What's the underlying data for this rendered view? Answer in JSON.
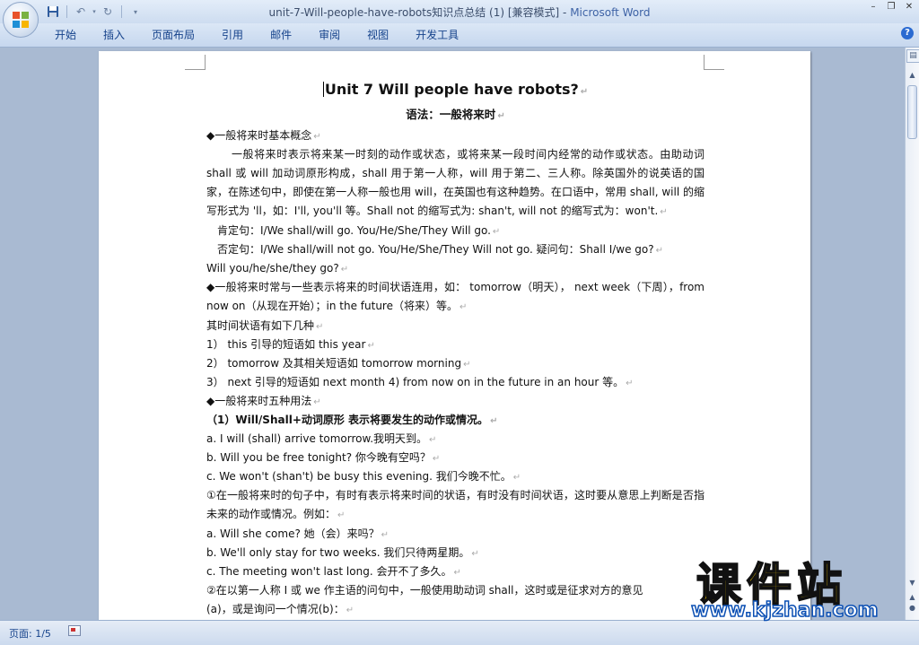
{
  "window": {
    "title_doc": "unit-7-Will-people-have-robots知识点总结 (1) [兼容模式] - ",
    "title_app": "Microsoft Word",
    "controls": [
      "–",
      "❐",
      "✕"
    ]
  },
  "qat": {
    "save_icon": "save-icon",
    "undo_icon": "undo-icon",
    "redo_icon": "redo-icon"
  },
  "ribbon": {
    "tabs": [
      "开始",
      "插入",
      "页面布局",
      "引用",
      "邮件",
      "审阅",
      "视图",
      "开发工具"
    ],
    "help": "?"
  },
  "document": {
    "title": "Unit 7 Will people have robots?",
    "subtitle": "语法：一般将来时",
    "lines": [
      "◆一般将来时基本概念",
      "一般将来时表示将来某一时刻的动作或状态，或将来某一段时间内经常的动作或状态。由助动词 shall 或 will 加动词原形构成，shall 用于第一人称，will 用于第二、三人称。除英国外的说英语的国家，在陈述句中，即使在第一人称一般也用 will，在英国也有这种趋势。在口语中，常用 shall, will 的缩写形式为 'll，如：I'll, you'll 等。Shall not 的缩写式为: shan't, will not 的缩写式为：won't.",
      "肯定句：I/We shall/will go.    You/He/She/They  Will go.",
      "否定句：I/We shall/will not go.    You/He/She/They  Will not go.     疑问句：Shall I/we go?",
      "Will you/he/she/they  go?",
      "◆一般将来时常与一些表示将来的时间状语连用，如： tomorrow（明天）， next week（下周），from now on（从现在开始）；in the future（将来）等。",
      "其时间状语有如下几种",
      "1） this 引导的短语如 this year",
      "2） tomorrow 及其相关短语如 tomorrow morning",
      "3） next 引导的短语如 next month 4) from now on  in the future  in an hour 等。",
      "◆一般将来时五种用法",
      "（1）Will/Shall+动词原形 表示将要发生的动作或情况。",
      "a. I will (shall) arrive tomorrow.我明天到。",
      "b. Will you be free tonight? 你今晚有空吗？",
      "c. We won't (shan't) be busy this evening. 我们今晚不忙。",
      "①在一般将来时的句子中，有时有表示将来时间的状语，有时没有时间状语，这时要从意思上判断是否指未来的动作或情况。例如：",
      "a. Will she come? 她（会）来吗？",
      "b. We'll only stay for two weeks. 我们只待两星期。",
      "c. The meeting won't last long. 会开不了多久。",
      "②在以第一人称 I 或 we 作主语的问句中，一般使用助动词 shall，这时或是征求对方的意见",
      "(a)，或是询问一个情况(b)："
    ],
    "paragraph_mark": "↵"
  },
  "status": {
    "page": "页面: 1/5"
  },
  "watermark": {
    "cn": "课件站",
    "url": "www.kjzhan.com"
  }
}
